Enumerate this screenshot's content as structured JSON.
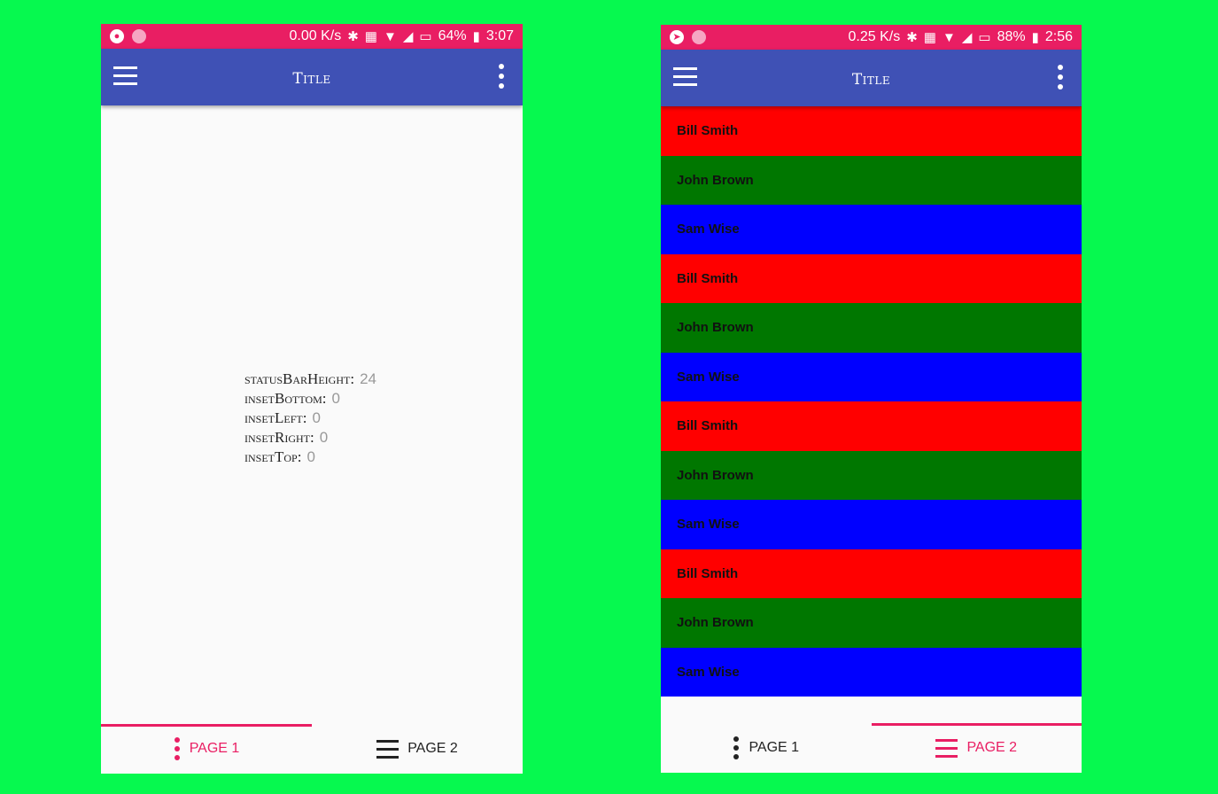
{
  "colors": {
    "background": "#06f94f",
    "status_bar": "#e91e63",
    "app_bar": "#3f51b5",
    "accent": "#e91e63",
    "row_red": "#ff0000",
    "row_green": "#007700",
    "row_blue": "#0000ff"
  },
  "left_screen": {
    "status_bar": {
      "speed": "0.00 K/s",
      "battery": "64%",
      "time": "3:07",
      "icons": [
        "reddit-icon",
        "notification-dot-icon",
        "bluetooth-icon",
        "nfc-icon",
        "wifi-icon",
        "signal-icon",
        "no-sim-icon",
        "battery-charging-icon"
      ]
    },
    "app_bar": {
      "title": "Title",
      "menu_icon": "hamburger-menu-icon",
      "more_icon": "more-vert-icon"
    },
    "insets": [
      {
        "label": "statusBarHeight",
        "value": "24"
      },
      {
        "label": "insetBottom",
        "value": "0"
      },
      {
        "label": "insetLeft",
        "value": "0"
      },
      {
        "label": "insetRight",
        "value": "0"
      },
      {
        "label": "insetTop",
        "value": "0"
      }
    ],
    "bottom_nav": {
      "tabs": [
        {
          "label": "PAGE 1",
          "icon": "more-vert-icon",
          "active": true
        },
        {
          "label": "PAGE 2",
          "icon": "hamburger-menu-icon",
          "active": false
        }
      ]
    }
  },
  "right_screen": {
    "status_bar": {
      "speed": "0.25 K/s",
      "battery": "88%",
      "time": "2:56",
      "icons": [
        "compass-icon",
        "notification-dot-icon",
        "bluetooth-icon",
        "nfc-icon",
        "wifi-icon",
        "signal-icon",
        "no-sim-icon",
        "battery-charging-icon"
      ]
    },
    "app_bar": {
      "title": "Title",
      "menu_icon": "hamburger-menu-icon",
      "more_icon": "more-vert-icon"
    },
    "list": [
      {
        "name": "Bill Smith",
        "color": "#ff0000"
      },
      {
        "name": "John Brown",
        "color": "#007700"
      },
      {
        "name": "Sam Wise",
        "color": "#0000ff"
      },
      {
        "name": "Bill Smith",
        "color": "#ff0000"
      },
      {
        "name": "John Brown",
        "color": "#007700"
      },
      {
        "name": "Sam Wise",
        "color": "#0000ff"
      },
      {
        "name": "Bill Smith",
        "color": "#ff0000"
      },
      {
        "name": "John Brown",
        "color": "#007700"
      },
      {
        "name": "Sam Wise",
        "color": "#0000ff"
      },
      {
        "name": "Bill Smith",
        "color": "#ff0000"
      },
      {
        "name": "John Brown",
        "color": "#007700"
      },
      {
        "name": "Sam Wise",
        "color": "#0000ff"
      }
    ],
    "bottom_nav": {
      "tabs": [
        {
          "label": "PAGE 1",
          "icon": "more-vert-icon",
          "active": false
        },
        {
          "label": "PAGE 2",
          "icon": "hamburger-menu-icon",
          "active": true
        }
      ]
    }
  }
}
